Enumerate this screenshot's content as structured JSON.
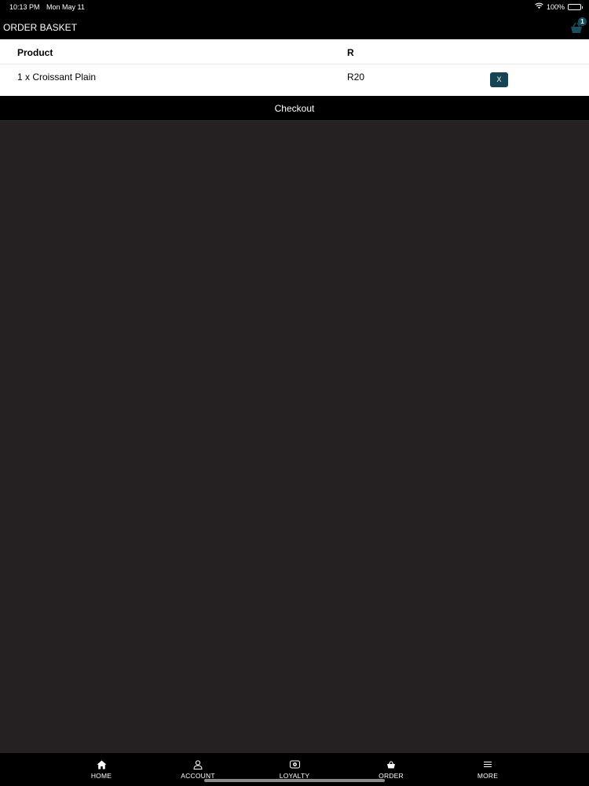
{
  "status_bar": {
    "time": "10:13 PM",
    "date": "Mon May 11",
    "battery": "100%"
  },
  "header": {
    "title": "ORDER BASKET",
    "basket_count": "1"
  },
  "table": {
    "headers": {
      "product": "Product",
      "price": "R"
    },
    "rows": [
      {
        "product": "1 x Croissant Plain",
        "price": "R20",
        "remove_label": "X"
      }
    ]
  },
  "checkout_label": "Checkout",
  "tabs": [
    {
      "label": "HOME",
      "icon": "home-icon"
    },
    {
      "label": "ACCOUNT",
      "icon": "account-icon"
    },
    {
      "label": "LOYALTY",
      "icon": "loyalty-icon"
    },
    {
      "label": "ORDER",
      "icon": "basket-icon"
    },
    {
      "label": "MORE",
      "icon": "menu-icon"
    }
  ],
  "colors": {
    "background": "#252123",
    "bar": "#000000",
    "accent": "#154454",
    "panel": "#ffffff"
  }
}
